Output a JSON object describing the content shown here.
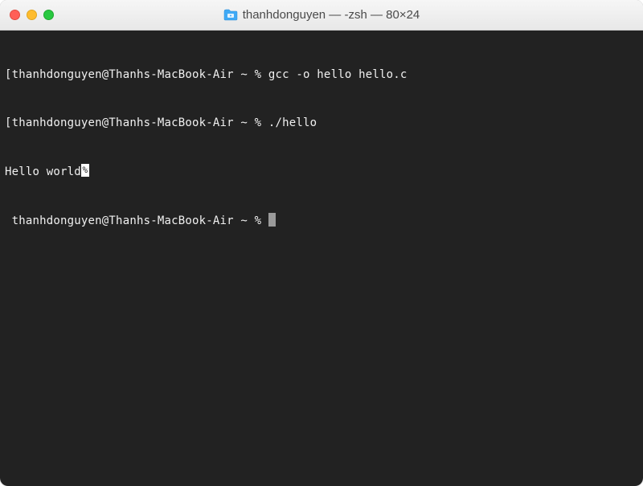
{
  "window": {
    "title": "thanhdonguyen — -zsh — 80×24"
  },
  "terminal": {
    "lines": [
      {
        "prompt": "[thanhdonguyen@Thanhs-MacBook-Air ~ % ",
        "command": "gcc -o hello hello.c"
      },
      {
        "prompt": "[thanhdonguyen@Thanhs-MacBook-Air ~ % ",
        "command": "./hello"
      },
      {
        "output": "Hello world"
      },
      {
        "prompt": " thanhdonguyen@Thanhs-MacBook-Air ~ % ",
        "cursor": true
      }
    ]
  }
}
